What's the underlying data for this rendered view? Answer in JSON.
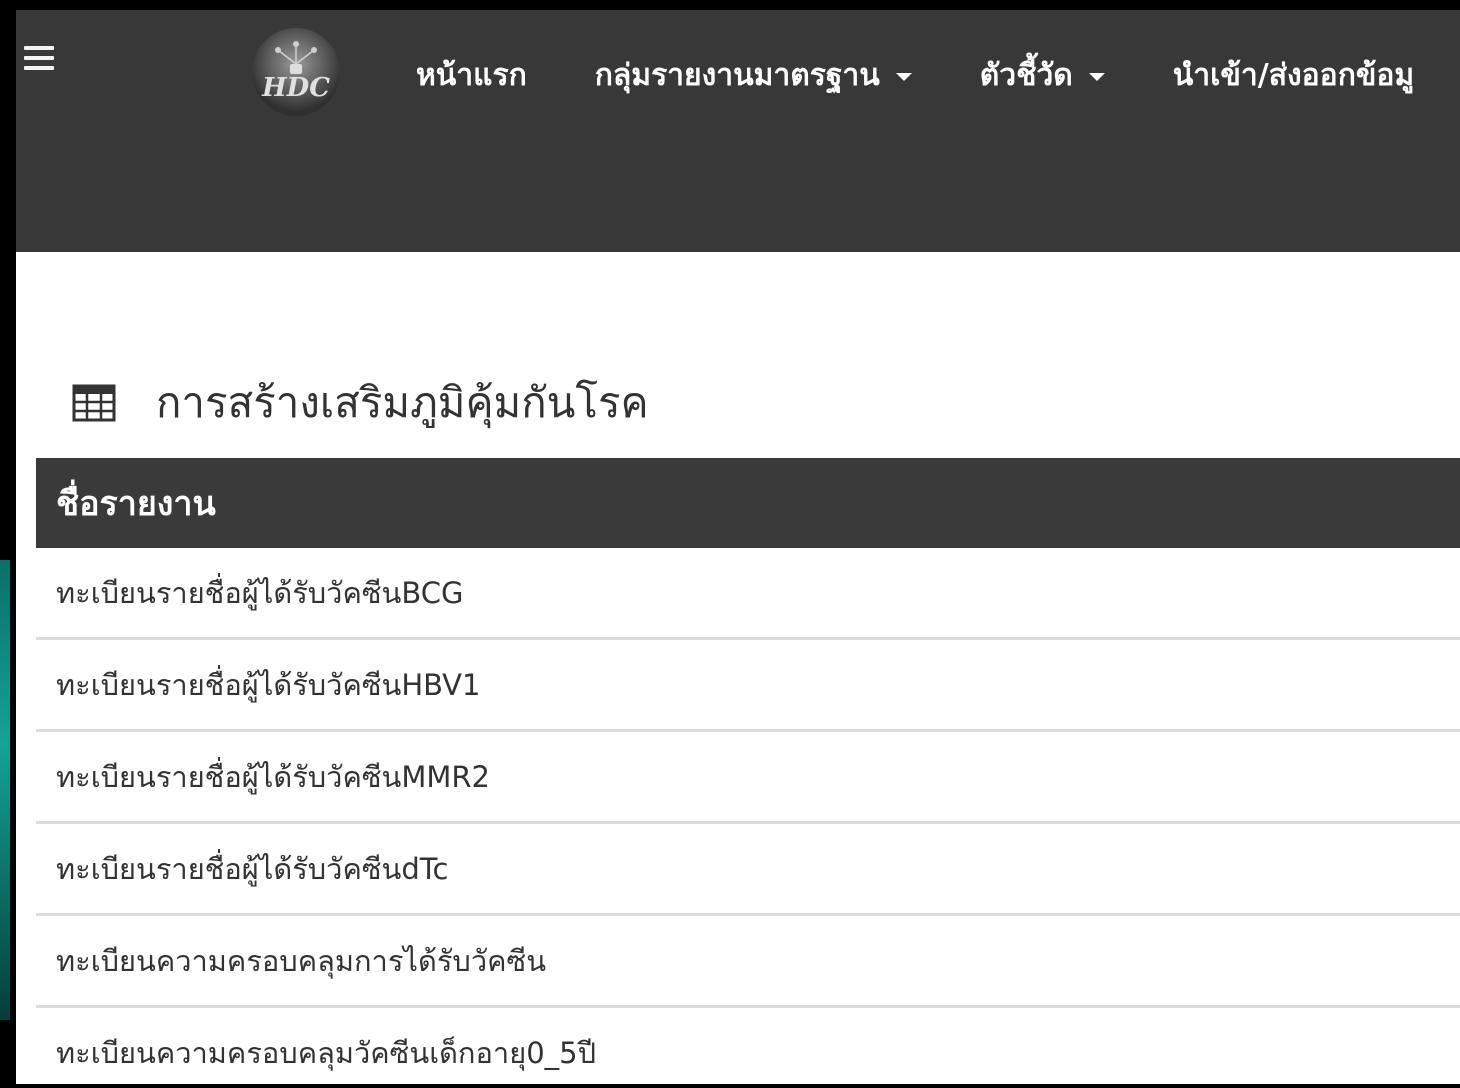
{
  "navbar": {
    "menu_icon": "hamburger-menu-icon",
    "logo_icon": "hdc-logo",
    "items": [
      {
        "label": "หน้าแรก",
        "has_dropdown": false
      },
      {
        "label": "กลุ่มรายงานมาตรฐาน",
        "has_dropdown": true
      },
      {
        "label": "ตัวชี้วัด",
        "has_dropdown": true
      },
      {
        "label": "นำเข้า/ส่งออกข้อมู",
        "has_dropdown": false
      }
    ]
  },
  "page": {
    "heading_icon": "table-icon",
    "heading": "การสร้างเสริมภูมิคุ้มกันโรค"
  },
  "table": {
    "header": "ชื่อรายงาน",
    "rows": [
      "ทะเบียนรายชื่อผู้ได้รับวัคซีนBCG",
      "ทะเบียนรายชื่อผู้ได้รับวัคซีนHBV1",
      "ทะเบียนรายชื่อผู้ได้รับวัคซีนMMR2",
      "ทะเบียนรายชื่อผู้ได้รับวัคซีนdTc",
      "ทะเบียนความครอบคลุมการได้รับวัคซีน",
      "ทะเบียนความครอบคลุมวัคซีนเด็กอายุ0_5ปี"
    ]
  },
  "colors": {
    "navbar_bg": "#383838",
    "table_header_bg": "#3a3a3a",
    "row_divider": "#dcdcdc",
    "text": "#333333"
  }
}
